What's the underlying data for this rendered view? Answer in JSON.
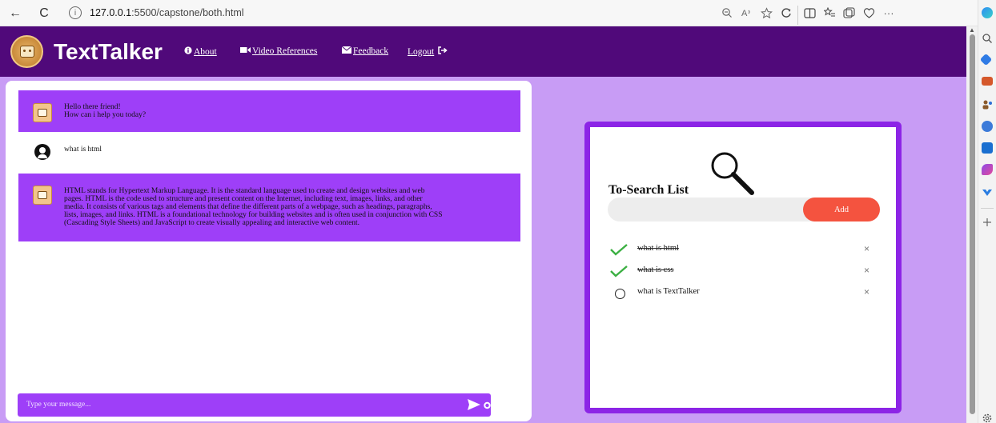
{
  "browser": {
    "back_icon": "←",
    "refresh_icon": "C",
    "info_icon": "i",
    "url_host": "127.0.0.1",
    "url_path": ":5500/capstone/both.html",
    "more_icon": "···"
  },
  "header": {
    "brand": "TextTalker",
    "nav": [
      {
        "icon": "info-circle-icon",
        "label": "About"
      },
      {
        "icon": "video-camera-icon",
        "label": "Video References"
      },
      {
        "icon": "envelope-icon",
        "label": "Feedback"
      },
      {
        "icon": "sign-out-icon",
        "label": "Logout"
      }
    ]
  },
  "chat": {
    "messages": [
      {
        "sender": "bot",
        "lines": [
          "Hello there friend!",
          "How can i help you today?"
        ]
      },
      {
        "sender": "user",
        "lines": [
          "what is html"
        ]
      },
      {
        "sender": "bot",
        "lines": [
          "HTML stands for Hypertext Markup Language. It is the standard language used to create and design websites and web",
          "pages. HTML is the code used to structure and present content on the Internet, including text, images, links, and other",
          "media. It consists of various tags and elements that define the different parts of a webpage, such as headings, paragraphs,",
          "lists, images, and links. HTML is a foundational technology for building websites and is often used in conjunction with CSS",
          "(Cascading Style Sheets) and JavaScript to create visually appealing and interactive web content."
        ]
      }
    ],
    "input_placeholder": "Type your message..."
  },
  "todo": {
    "title": "To-Search List",
    "add_label": "Add",
    "close_symbol": "×",
    "items": [
      {
        "text": "what is html",
        "done": true
      },
      {
        "text": "what is css",
        "done": true
      },
      {
        "text": "what is TextTalker",
        "done": false
      }
    ]
  },
  "colors": {
    "header_bg": "#50097a",
    "main_bg": "#c89cf5",
    "bot_bubble": "#9e3ff8",
    "todo_border": "#8c24e6",
    "add_button": "#f4533f",
    "check_green": "#3cb043"
  }
}
